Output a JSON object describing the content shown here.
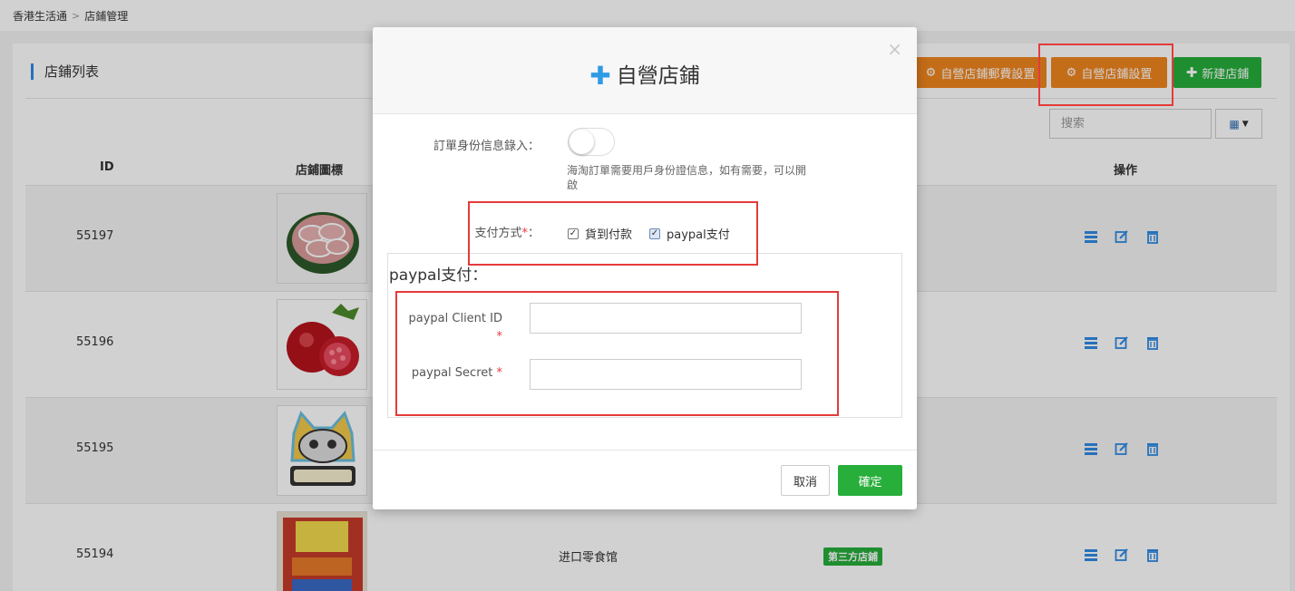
{
  "breadcrumb": {
    "root": "香港生活通",
    "sep": ">",
    "current": "店鋪管理"
  },
  "panel": {
    "title": "店鋪列表"
  },
  "toolbar": {
    "freight_label": "自營店鋪郵費設置",
    "settings_label": "自營店鋪設置",
    "new_label": "新建店鋪",
    "search_placeholder": "搜索"
  },
  "table": {
    "headers": {
      "id": "ID",
      "logo": "店鋪圖標",
      "ops": "操作"
    },
    "rows": [
      {
        "id": "55197"
      },
      {
        "id": "55196"
      },
      {
        "id": "55195"
      },
      {
        "id": "55194",
        "name": "进口零食馆",
        "badge": "第三方店鋪"
      }
    ]
  },
  "modal": {
    "title": "自營店鋪",
    "close": "×",
    "id_entry_label": "訂單身份信息錄入：",
    "id_entry_help": "海淘訂單需要用戶身份證信息，如有需要，可以開啟",
    "id_entry_enabled": false,
    "payment_label": "支付方式",
    "required_mark": "*",
    "colon": "：",
    "payment_options": [
      {
        "label": "貨到付款",
        "checked": true
      },
      {
        "label": "paypal支付",
        "checked": true
      }
    ],
    "paypal_section_title": "paypal支付：",
    "paypal_client_id_label": "paypal Client ID",
    "paypal_secret_label": "paypal Secret",
    "cancel_label": "取消",
    "ok_label": "確定"
  },
  "colors": {
    "accent": "#2f9be5",
    "orange": "#f0861f",
    "green": "#27ae3b",
    "annotation": "#e43b3b"
  }
}
